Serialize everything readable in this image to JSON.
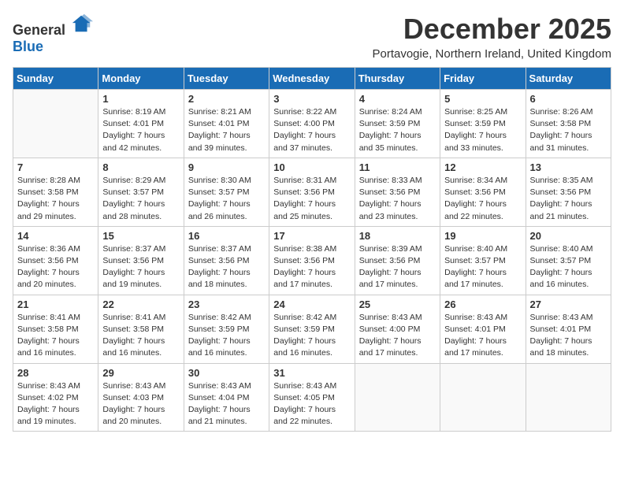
{
  "logo": {
    "general": "General",
    "blue": "Blue"
  },
  "title": "December 2025",
  "location": "Portavogie, Northern Ireland, United Kingdom",
  "weekdays": [
    "Sunday",
    "Monday",
    "Tuesday",
    "Wednesday",
    "Thursday",
    "Friday",
    "Saturday"
  ],
  "weeks": [
    [
      {
        "day": null,
        "info": null
      },
      {
        "day": "1",
        "info": "Sunrise: 8:19 AM\nSunset: 4:01 PM\nDaylight: 7 hours\nand 42 minutes."
      },
      {
        "day": "2",
        "info": "Sunrise: 8:21 AM\nSunset: 4:01 PM\nDaylight: 7 hours\nand 39 minutes."
      },
      {
        "day": "3",
        "info": "Sunrise: 8:22 AM\nSunset: 4:00 PM\nDaylight: 7 hours\nand 37 minutes."
      },
      {
        "day": "4",
        "info": "Sunrise: 8:24 AM\nSunset: 3:59 PM\nDaylight: 7 hours\nand 35 minutes."
      },
      {
        "day": "5",
        "info": "Sunrise: 8:25 AM\nSunset: 3:59 PM\nDaylight: 7 hours\nand 33 minutes."
      },
      {
        "day": "6",
        "info": "Sunrise: 8:26 AM\nSunset: 3:58 PM\nDaylight: 7 hours\nand 31 minutes."
      }
    ],
    [
      {
        "day": "7",
        "info": "Sunrise: 8:28 AM\nSunset: 3:58 PM\nDaylight: 7 hours\nand 29 minutes."
      },
      {
        "day": "8",
        "info": "Sunrise: 8:29 AM\nSunset: 3:57 PM\nDaylight: 7 hours\nand 28 minutes."
      },
      {
        "day": "9",
        "info": "Sunrise: 8:30 AM\nSunset: 3:57 PM\nDaylight: 7 hours\nand 26 minutes."
      },
      {
        "day": "10",
        "info": "Sunrise: 8:31 AM\nSunset: 3:56 PM\nDaylight: 7 hours\nand 25 minutes."
      },
      {
        "day": "11",
        "info": "Sunrise: 8:33 AM\nSunset: 3:56 PM\nDaylight: 7 hours\nand 23 minutes."
      },
      {
        "day": "12",
        "info": "Sunrise: 8:34 AM\nSunset: 3:56 PM\nDaylight: 7 hours\nand 22 minutes."
      },
      {
        "day": "13",
        "info": "Sunrise: 8:35 AM\nSunset: 3:56 PM\nDaylight: 7 hours\nand 21 minutes."
      }
    ],
    [
      {
        "day": "14",
        "info": "Sunrise: 8:36 AM\nSunset: 3:56 PM\nDaylight: 7 hours\nand 20 minutes."
      },
      {
        "day": "15",
        "info": "Sunrise: 8:37 AM\nSunset: 3:56 PM\nDaylight: 7 hours\nand 19 minutes."
      },
      {
        "day": "16",
        "info": "Sunrise: 8:37 AM\nSunset: 3:56 PM\nDaylight: 7 hours\nand 18 minutes."
      },
      {
        "day": "17",
        "info": "Sunrise: 8:38 AM\nSunset: 3:56 PM\nDaylight: 7 hours\nand 17 minutes."
      },
      {
        "day": "18",
        "info": "Sunrise: 8:39 AM\nSunset: 3:56 PM\nDaylight: 7 hours\nand 17 minutes."
      },
      {
        "day": "19",
        "info": "Sunrise: 8:40 AM\nSunset: 3:57 PM\nDaylight: 7 hours\nand 17 minutes."
      },
      {
        "day": "20",
        "info": "Sunrise: 8:40 AM\nSunset: 3:57 PM\nDaylight: 7 hours\nand 16 minutes."
      }
    ],
    [
      {
        "day": "21",
        "info": "Sunrise: 8:41 AM\nSunset: 3:58 PM\nDaylight: 7 hours\nand 16 minutes."
      },
      {
        "day": "22",
        "info": "Sunrise: 8:41 AM\nSunset: 3:58 PM\nDaylight: 7 hours\nand 16 minutes."
      },
      {
        "day": "23",
        "info": "Sunrise: 8:42 AM\nSunset: 3:59 PM\nDaylight: 7 hours\nand 16 minutes."
      },
      {
        "day": "24",
        "info": "Sunrise: 8:42 AM\nSunset: 3:59 PM\nDaylight: 7 hours\nand 16 minutes."
      },
      {
        "day": "25",
        "info": "Sunrise: 8:43 AM\nSunset: 4:00 PM\nDaylight: 7 hours\nand 17 minutes."
      },
      {
        "day": "26",
        "info": "Sunrise: 8:43 AM\nSunset: 4:01 PM\nDaylight: 7 hours\nand 17 minutes."
      },
      {
        "day": "27",
        "info": "Sunrise: 8:43 AM\nSunset: 4:01 PM\nDaylight: 7 hours\nand 18 minutes."
      }
    ],
    [
      {
        "day": "28",
        "info": "Sunrise: 8:43 AM\nSunset: 4:02 PM\nDaylight: 7 hours\nand 19 minutes."
      },
      {
        "day": "29",
        "info": "Sunrise: 8:43 AM\nSunset: 4:03 PM\nDaylight: 7 hours\nand 20 minutes."
      },
      {
        "day": "30",
        "info": "Sunrise: 8:43 AM\nSunset: 4:04 PM\nDaylight: 7 hours\nand 21 minutes."
      },
      {
        "day": "31",
        "info": "Sunrise: 8:43 AM\nSunset: 4:05 PM\nDaylight: 7 hours\nand 22 minutes."
      },
      {
        "day": null,
        "info": null
      },
      {
        "day": null,
        "info": null
      },
      {
        "day": null,
        "info": null
      }
    ]
  ]
}
